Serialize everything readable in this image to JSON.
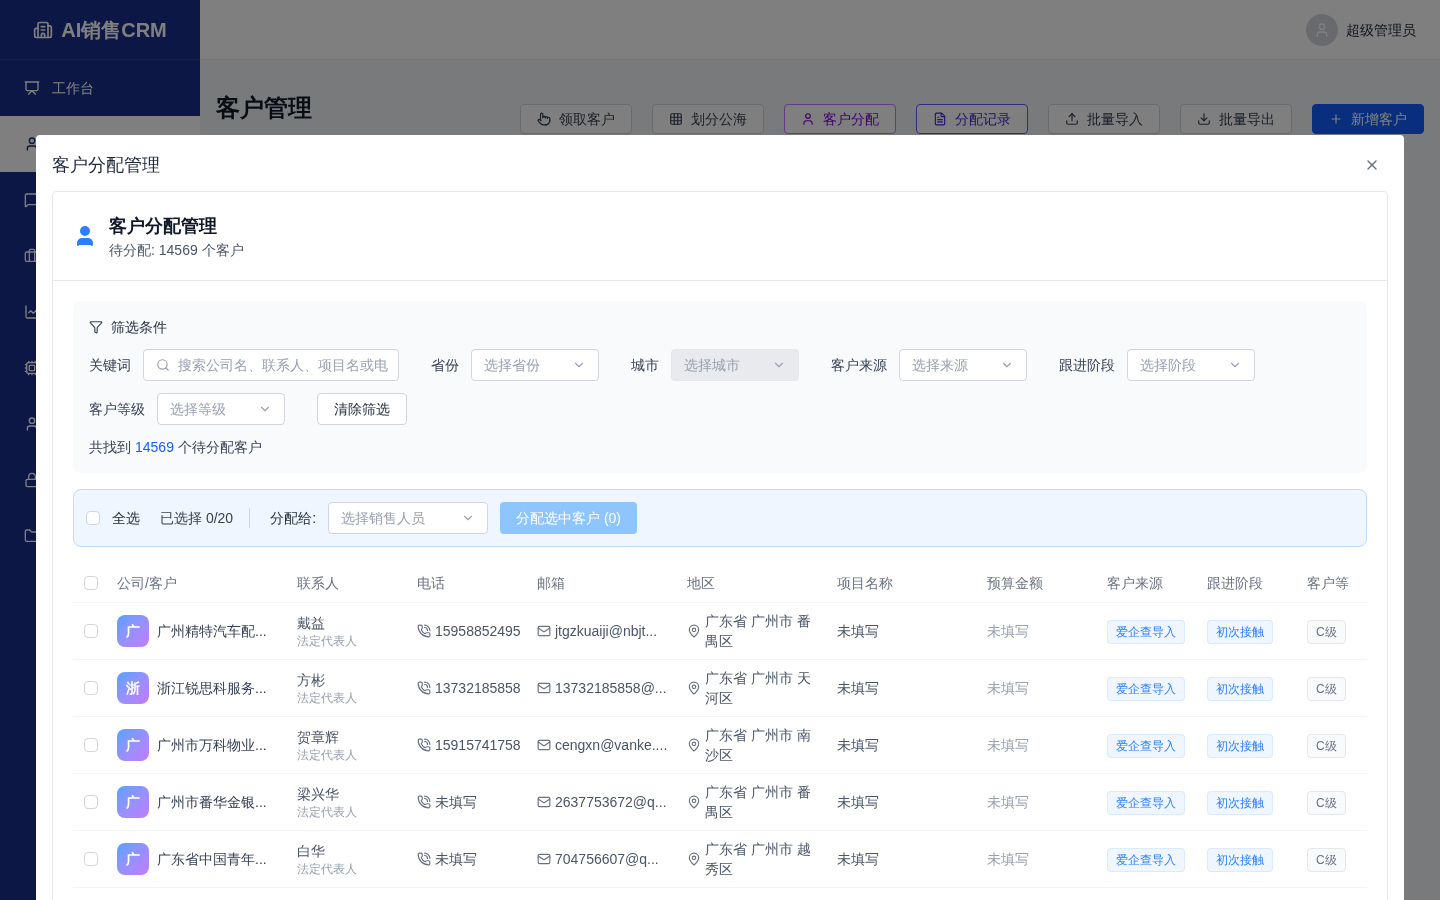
{
  "sidebar": {
    "brand": "AI销售CRM",
    "items": [
      {
        "label": "工作台",
        "selected": false
      },
      {
        "selected": true
      },
      {
        "selected": false
      },
      {
        "selected": false
      },
      {
        "selected": false
      },
      {
        "selected": false
      },
      {
        "selected": false
      },
      {
        "selected": false
      },
      {
        "selected": false
      }
    ]
  },
  "header": {
    "user": "超级管理员"
  },
  "page": {
    "title": "客户管理",
    "actions": [
      {
        "label": "领取客户",
        "kind": "plain"
      },
      {
        "label": "划分公海",
        "kind": "plain"
      },
      {
        "label": "客户分配",
        "kind": "purple"
      },
      {
        "label": "分配记录",
        "kind": "indigo"
      },
      {
        "label": "批量导入",
        "kind": "plain"
      },
      {
        "label": "批量导出",
        "kind": "plain"
      },
      {
        "label": "新增客户",
        "kind": "primary"
      }
    ]
  },
  "dialog": {
    "title": "客户分配管理",
    "card_title": "客户分配管理",
    "card_subtitle": "待分配: 14569 个客户",
    "filters": {
      "title": "筛选条件",
      "fields": [
        {
          "label": "关键词",
          "kind": "search",
          "placeholder": "搜索公司名、联系人、项目名或电",
          "disabled": false
        },
        {
          "label": "省份",
          "kind": "select",
          "placeholder": "选择省份",
          "disabled": false
        },
        {
          "label": "城市",
          "kind": "select",
          "placeholder": "选择城市",
          "disabled": true
        },
        {
          "label": "客户来源",
          "kind": "select",
          "placeholder": "选择来源",
          "disabled": false
        },
        {
          "label": "跟进阶段",
          "kind": "select",
          "placeholder": "选择阶段",
          "disabled": false
        },
        {
          "label": "客户等级",
          "kind": "select",
          "placeholder": "选择等级",
          "disabled": false
        }
      ],
      "clear_button": "清除筛选",
      "result_prefix": "共找到",
      "result_count": "14569",
      "result_suffix": "个待分配客户"
    },
    "assign_bar": {
      "select_all": "全选",
      "checked": false,
      "selected_count": "已选择 0/20",
      "assign_label": "分配给:",
      "assignee_placeholder": "选择销售人员",
      "assign_button": "分配选中客户 (0)",
      "assign_disabled": true
    },
    "table": {
      "all_checked": false,
      "columns": [
        "公司/客户",
        "联系人",
        "电话",
        "邮箱",
        "地区",
        "项目名称",
        "预算金额",
        "客户来源",
        "跟进阶段",
        "客户等"
      ],
      "rows": [
        {
          "checked": false,
          "avatar": "广",
          "company": "广州精特汽车配...",
          "contact": "戴益",
          "role": "法定代表人",
          "phone": "15958852495",
          "email": "jtgzkuaiji@nbjt...",
          "region": "广东省 广州市 番禺区",
          "project": "未填写",
          "budget": "未填写",
          "source": "爱企查导入",
          "stage": "初次接触",
          "level": "C级"
        },
        {
          "checked": false,
          "avatar": "浙",
          "company": "浙江锐思科服务...",
          "contact": "方彬",
          "role": "法定代表人",
          "phone": "13732185858",
          "email": "13732185858@...",
          "region": "广东省 广州市 天河区",
          "project": "未填写",
          "budget": "未填写",
          "source": "爱企查导入",
          "stage": "初次接触",
          "level": "C级"
        },
        {
          "checked": false,
          "avatar": "广",
          "company": "广州市万科物业...",
          "contact": "贺章辉",
          "role": "法定代表人",
          "phone": "15915741758",
          "email": "cengxn@vanke....",
          "region": "广东省 广州市 南沙区",
          "project": "未填写",
          "budget": "未填写",
          "source": "爱企查导入",
          "stage": "初次接触",
          "level": "C级"
        },
        {
          "checked": false,
          "avatar": "广",
          "company": "广州市番华金银...",
          "contact": "梁兴华",
          "role": "法定代表人",
          "phone": "未填写",
          "email": "2637753672@q...",
          "region": "广东省 广州市 番禺区",
          "project": "未填写",
          "budget": "未填写",
          "source": "爱企查导入",
          "stage": "初次接触",
          "level": "C级"
        },
        {
          "checked": false,
          "avatar": "广",
          "company": "广东省中国青年...",
          "contact": "白华",
          "role": "法定代表人",
          "phone": "未填写",
          "email": "704756607@q...",
          "region": "广东省 广州市 越秀区",
          "project": "未填写",
          "budget": "未填写",
          "source": "爱企查导入",
          "stage": "初次接触",
          "level": "C级"
        }
      ]
    }
  }
}
